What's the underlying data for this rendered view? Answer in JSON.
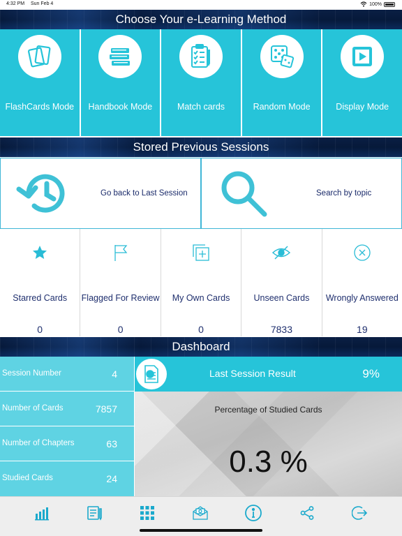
{
  "status": {
    "time": "4:32 PM",
    "date": "Sun Feb 4",
    "battery": "100%"
  },
  "header": {
    "title": "Choose Your e-Learning Method"
  },
  "modes": [
    {
      "label": "FlashCards Mode",
      "icon": "flashcards-icon"
    },
    {
      "label": "Handbook Mode",
      "icon": "books-icon"
    },
    {
      "label": "Match cards",
      "icon": "clipboard-checklist-icon"
    },
    {
      "label": "Random Mode",
      "icon": "dice-icon"
    },
    {
      "label": "Display Mode",
      "icon": "play-icon"
    }
  ],
  "sessions": {
    "title": "Stored Previous Sessions",
    "last_session": "Go back to Last Session",
    "search_topic": "Search by topic"
  },
  "filters": [
    {
      "label": "Starred Cards",
      "count": "0",
      "icon": "star-icon"
    },
    {
      "label": "Flagged For Review",
      "count": "0",
      "icon": "flag-icon"
    },
    {
      "label": "My Own Cards",
      "count": "0",
      "icon": "add-card-icon"
    },
    {
      "label": "Unseen Cards",
      "count": "7833",
      "icon": "eye-off-icon"
    },
    {
      "label": "Wrongly Answered",
      "count": "19",
      "icon": "x-circle-icon"
    }
  ],
  "dashboard": {
    "title": "Dashboard",
    "stats": [
      {
        "label": "Session Number",
        "value": "4"
      },
      {
        "label": "Number of Cards",
        "value": "7857"
      },
      {
        "label": "Number of Chapters",
        "value": "63"
      },
      {
        "label": "Studied Cards",
        "value": "24"
      }
    ],
    "last_result_label": "Last Session Result",
    "last_result_value": "9%",
    "studied_title": "Percentage of Studied Cards",
    "studied_value": "0.3 %"
  },
  "tabbar": [
    "bar-chart-icon",
    "notes-icon",
    "grid-icon",
    "mail-icon",
    "info-icon",
    "share-icon",
    "exit-icon"
  ],
  "colors": {
    "accent": "#26c4d9",
    "light_accent": "#5fd3e3",
    "navy": "#0a1f44",
    "text_dark": "#1f2f6e"
  }
}
